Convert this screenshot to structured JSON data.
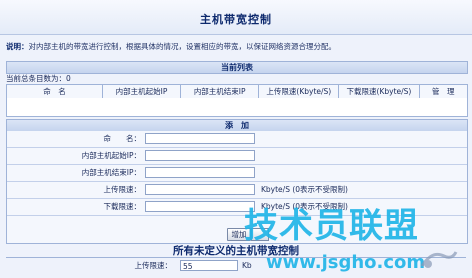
{
  "header": {
    "title": "主机带宽控制"
  },
  "description": {
    "label": "说明：",
    "text": "对内部主机的带宽进行控制，根据具体的情况，设置相应的带宽，以保证网络资源合理分配。"
  },
  "current_list": {
    "title": "当前列表",
    "count_label": "当前总条目数为：",
    "count_value": "0",
    "columns": [
      "命　名",
      "内部主机起始IP",
      "内部主机结束IP",
      "上传限速(Kbyte/S)",
      "下载限速(Kbyte/S)",
      "管　理"
    ]
  },
  "add_form": {
    "title": "添　加",
    "name_label": "命　　名：",
    "start_ip_label": "内部主机起始IP：",
    "end_ip_label": "内部主机结束IP：",
    "upload_label": "上传限速：",
    "download_label": "下载限速：",
    "upload_unit": "Kbyte/S (0表示不受限制)",
    "download_unit": "Kbyte/S (0表示不受限制)",
    "add_button": "增加"
  },
  "undefined_hosts": {
    "title": "所有未定义的主机带宽控制",
    "upload_label": "上传限速：",
    "upload_value": "55",
    "upload_unit": "Kb"
  },
  "watermark": {
    "brand": "技术员联盟",
    "url": "www.jsgho.com"
  }
}
